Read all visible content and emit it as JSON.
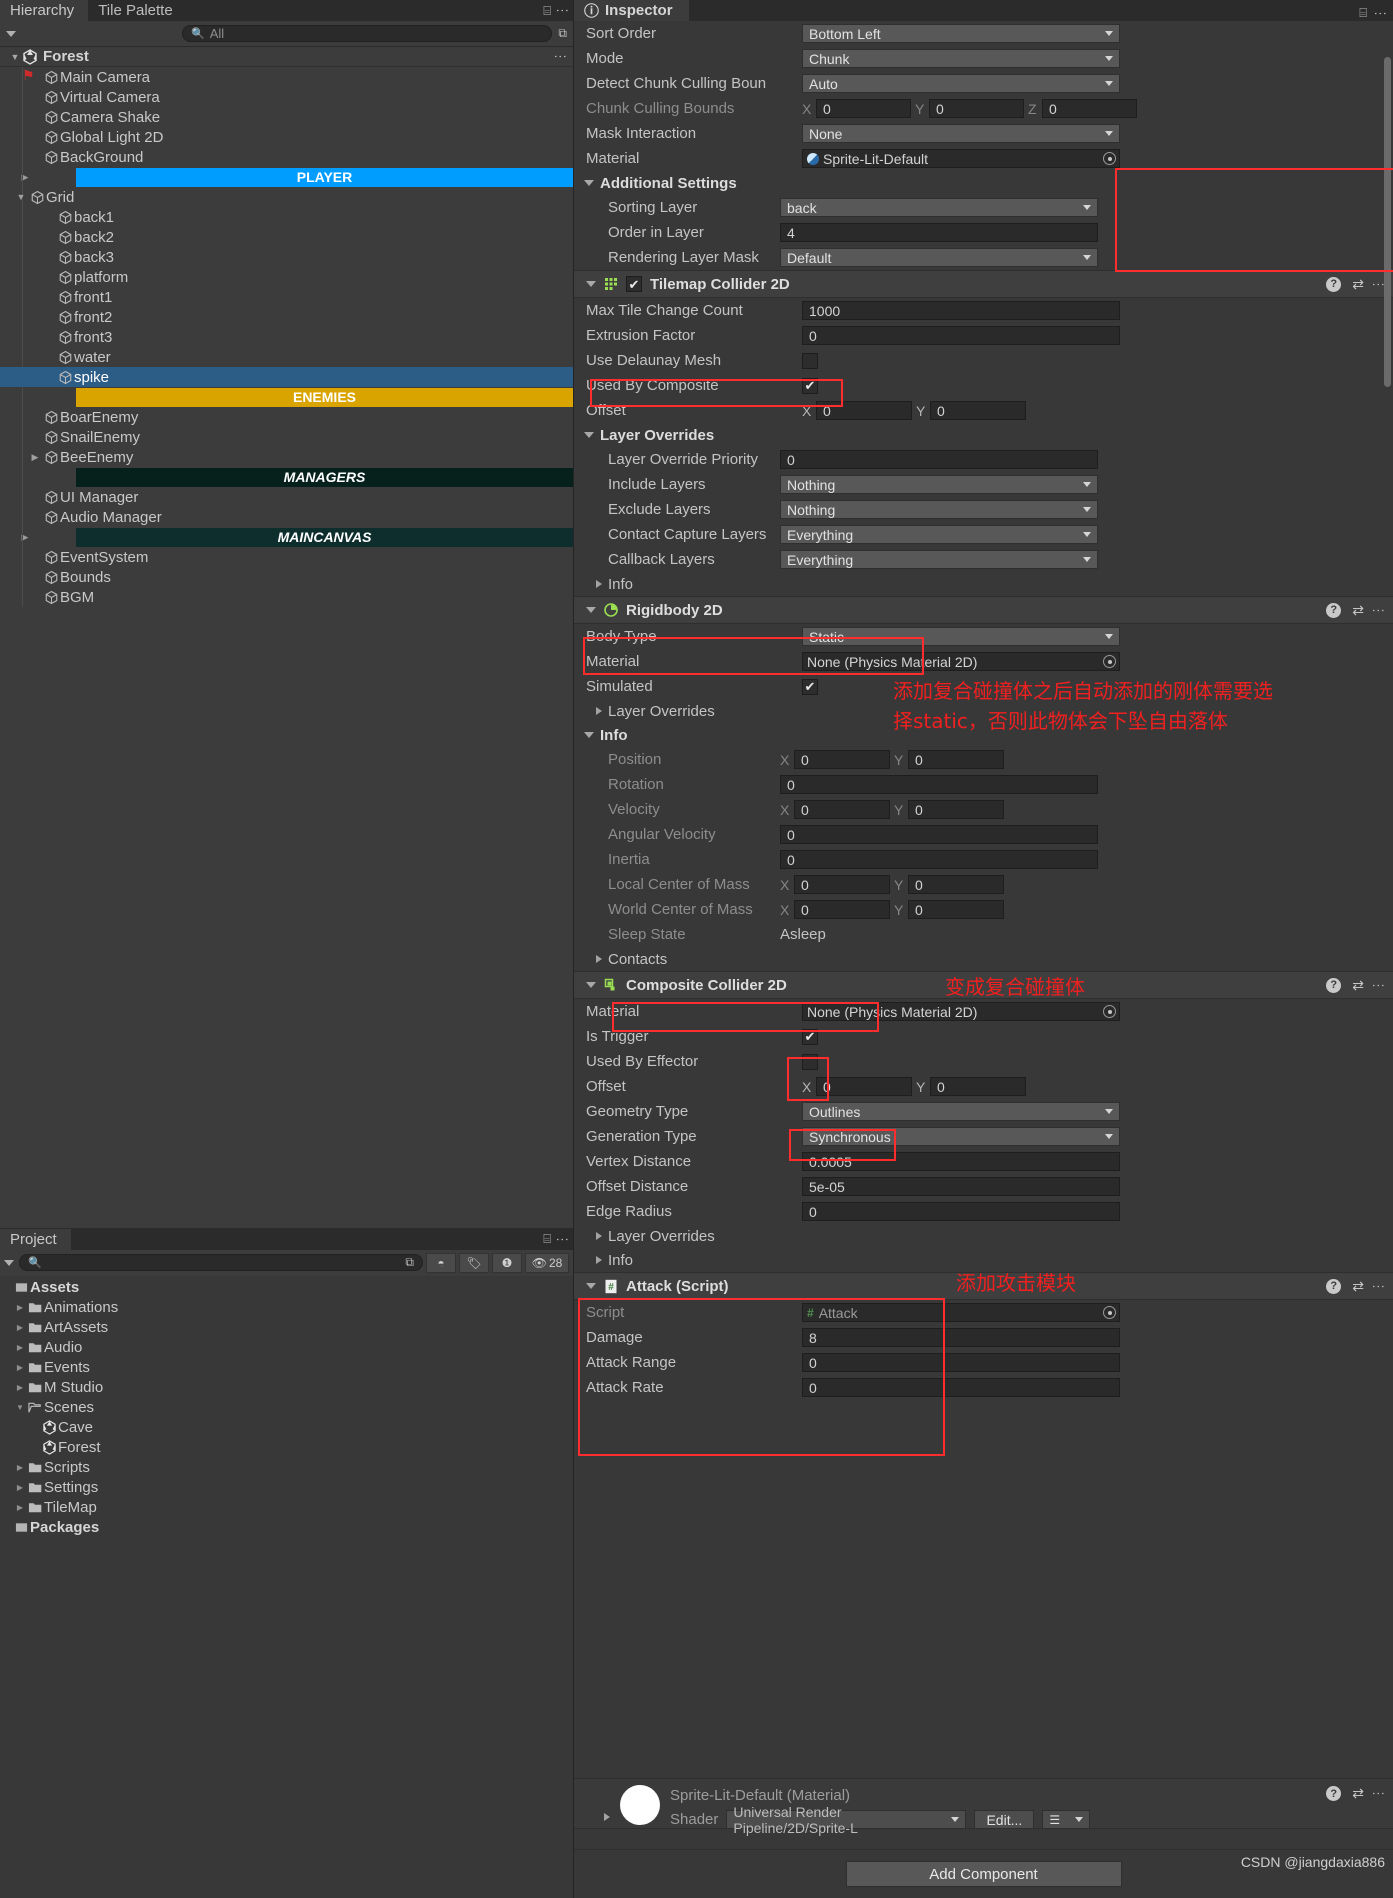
{
  "hierarchy": {
    "tabs": [
      {
        "label": "Hierarchy",
        "active": true
      },
      {
        "label": "Tile Palette",
        "active": false
      }
    ],
    "search_placeholder": "All",
    "scene_name": "Forest",
    "items": [
      {
        "label": "Main Camera",
        "indent": 2,
        "arrow": false,
        "type": "go"
      },
      {
        "label": "Virtual Camera",
        "indent": 2,
        "arrow": false,
        "type": "go"
      },
      {
        "label": "Camera Shake",
        "indent": 2,
        "arrow": false,
        "type": "go"
      },
      {
        "label": "Global Light 2D",
        "indent": 2,
        "arrow": false,
        "type": "go"
      },
      {
        "label": "BackGround",
        "indent": 2,
        "arrow": false,
        "type": "go"
      },
      {
        "label": "PLAYER",
        "indent": 2,
        "arrow": true,
        "type": "banner",
        "style": "player"
      },
      {
        "label": "Grid",
        "indent": 1,
        "arrow": true,
        "type": "go",
        "expanded": true
      },
      {
        "label": "back1",
        "indent": 3,
        "arrow": false,
        "type": "go"
      },
      {
        "label": "back2",
        "indent": 3,
        "arrow": false,
        "type": "go"
      },
      {
        "label": "back3",
        "indent": 3,
        "arrow": false,
        "type": "go"
      },
      {
        "label": "platform",
        "indent": 3,
        "arrow": false,
        "type": "go"
      },
      {
        "label": "front1",
        "indent": 3,
        "arrow": false,
        "type": "go"
      },
      {
        "label": "front2",
        "indent": 3,
        "arrow": false,
        "type": "go"
      },
      {
        "label": "front3",
        "indent": 3,
        "arrow": false,
        "type": "go"
      },
      {
        "label": "water",
        "indent": 3,
        "arrow": false,
        "type": "go"
      },
      {
        "label": "spike",
        "indent": 3,
        "arrow": false,
        "type": "go",
        "selected": true
      },
      {
        "label": "ENEMIES",
        "indent": 2,
        "arrow": false,
        "type": "banner",
        "style": "enemies"
      },
      {
        "label": "BoarEnemy",
        "indent": 2,
        "arrow": false,
        "type": "go"
      },
      {
        "label": "SnailEnemy",
        "indent": 2,
        "arrow": false,
        "type": "go"
      },
      {
        "label": "BeeEnemy",
        "indent": 2,
        "arrow": true,
        "type": "go"
      },
      {
        "label": "MANAGERS",
        "indent": 2,
        "arrow": false,
        "type": "banner",
        "style": "managers"
      },
      {
        "label": "UI Manager",
        "indent": 2,
        "arrow": false,
        "type": "go"
      },
      {
        "label": "Audio Manager",
        "indent": 2,
        "arrow": false,
        "type": "go"
      },
      {
        "label": "MAINCANVAS",
        "indent": 2,
        "arrow": true,
        "type": "banner",
        "style": "maincanvas"
      },
      {
        "label": "EventSystem",
        "indent": 2,
        "arrow": false,
        "type": "go"
      },
      {
        "label": "Bounds",
        "indent": 2,
        "arrow": false,
        "type": "go"
      },
      {
        "label": "BGM",
        "indent": 2,
        "arrow": false,
        "type": "go"
      }
    ]
  },
  "project": {
    "tab_label": "Project",
    "search_placeholder": "",
    "hidden_count": "28",
    "items": [
      {
        "label": "Assets",
        "indent": 0,
        "bold": true,
        "icon": "assets-icon",
        "arrow": false
      },
      {
        "label": "Animations",
        "indent": 1,
        "bold": false,
        "icon": "folder-icon",
        "arrow": true
      },
      {
        "label": "ArtAssets",
        "indent": 1,
        "bold": false,
        "icon": "folder-icon",
        "arrow": true
      },
      {
        "label": "Audio",
        "indent": 1,
        "bold": false,
        "icon": "folder-icon",
        "arrow": true
      },
      {
        "label": "Events",
        "indent": 1,
        "bold": false,
        "icon": "folder-icon",
        "arrow": true
      },
      {
        "label": "M Studio",
        "indent": 1,
        "bold": false,
        "icon": "folder-icon",
        "arrow": true
      },
      {
        "label": "Scenes",
        "indent": 1,
        "bold": false,
        "icon": "folder-open-icon",
        "arrow": true,
        "expanded": true
      },
      {
        "label": "Cave",
        "indent": 2,
        "bold": false,
        "icon": "unity-scene-icon",
        "arrow": false
      },
      {
        "label": "Forest",
        "indent": 2,
        "bold": false,
        "icon": "unity-scene-icon",
        "arrow": false
      },
      {
        "label": "Scripts",
        "indent": 1,
        "bold": false,
        "icon": "folder-icon",
        "arrow": true
      },
      {
        "label": "Settings",
        "indent": 1,
        "bold": false,
        "icon": "folder-icon",
        "arrow": true
      },
      {
        "label": "TileMap",
        "indent": 1,
        "bold": false,
        "icon": "folder-icon",
        "arrow": true
      },
      {
        "label": "Packages",
        "indent": 0,
        "bold": true,
        "icon": "assets-icon",
        "arrow": false
      }
    ]
  },
  "inspector": {
    "tab_label": "Inspector",
    "renderer_props": [
      {
        "label": "Sort Order",
        "value": "Bottom Left",
        "kind": "dropdown"
      },
      {
        "label": "Mode",
        "value": "Chunk",
        "kind": "dropdown"
      },
      {
        "label": "Detect Chunk Culling Boun",
        "value": "Auto",
        "kind": "dropdown"
      },
      {
        "label": "Chunk Culling Bounds",
        "kind": "xyz",
        "dim": true,
        "x": "0",
        "y": "0",
        "z": "0"
      },
      {
        "label": "Mask Interaction",
        "value": "None",
        "kind": "dropdown"
      },
      {
        "label": "Material",
        "value": "Sprite-Lit-Default",
        "kind": "object"
      }
    ],
    "additional_settings": {
      "title": "Additional Settings",
      "props": [
        {
          "label": "Sorting Layer",
          "value": "back",
          "kind": "dropdown"
        },
        {
          "label": "Order in Layer",
          "value": "4",
          "kind": "field"
        },
        {
          "label": "Rendering Layer Mask",
          "value": "Default",
          "kind": "dropdown"
        }
      ]
    },
    "tilemap_collider": {
      "title": "Tilemap Collider 2D",
      "enabled": true,
      "props": [
        {
          "label": "Max Tile Change Count",
          "value": "1000",
          "kind": "field"
        },
        {
          "label": "Extrusion Factor",
          "value": "0",
          "kind": "field"
        },
        {
          "label": "Use Delaunay Mesh",
          "kind": "check",
          "checked": false
        },
        {
          "label": "Used By Composite",
          "kind": "check",
          "checked": true
        },
        {
          "label": "Offset",
          "kind": "xy",
          "x": "0",
          "y": "0"
        }
      ],
      "layer_overrides_title": "Layer Overrides",
      "layer_overrides": [
        {
          "label": "Layer Override Priority",
          "value": "0",
          "kind": "field"
        },
        {
          "label": "Include Layers",
          "value": "Nothing",
          "kind": "dropdown"
        },
        {
          "label": "Exclude Layers",
          "value": "Nothing",
          "kind": "dropdown"
        },
        {
          "label": "Contact Capture Layers",
          "value": "Everything",
          "kind": "dropdown"
        },
        {
          "label": "Callback Layers",
          "value": "Everything",
          "kind": "dropdown"
        }
      ],
      "info_label": "Info"
    },
    "rigidbody": {
      "title": "Rigidbody 2D",
      "props": [
        {
          "label": "Body Type",
          "value": "Static",
          "kind": "dropdown"
        },
        {
          "label": "Material",
          "value": "None (Physics Material 2D)",
          "kind": "object"
        },
        {
          "label": "Simulated",
          "kind": "check",
          "checked": true
        }
      ],
      "layer_overrides_title": "Layer Overrides",
      "info_label": "Info",
      "info_props": [
        {
          "label": "Position",
          "kind": "xy",
          "x": "0",
          "y": "0"
        },
        {
          "label": "Rotation",
          "value": "0",
          "kind": "field"
        },
        {
          "label": "Velocity",
          "kind": "xy",
          "x": "0",
          "y": "0"
        },
        {
          "label": "Angular Velocity",
          "value": "0",
          "kind": "field"
        },
        {
          "label": "Inertia",
          "value": "0",
          "kind": "field"
        },
        {
          "label": "Local Center of Mass",
          "kind": "xy",
          "x": "0",
          "y": "0"
        },
        {
          "label": "World Center of Mass",
          "kind": "xy",
          "x": "0",
          "y": "0"
        },
        {
          "label": "Sleep State",
          "value": "Asleep",
          "kind": "text"
        }
      ],
      "contacts_label": "Contacts"
    },
    "composite_collider": {
      "title": "Composite Collider 2D",
      "props": [
        {
          "label": "Material",
          "value": "None (Physics Material 2D)",
          "kind": "object"
        },
        {
          "label": "Is Trigger",
          "kind": "check",
          "checked": true
        },
        {
          "label": "Used By Effector",
          "kind": "check",
          "checked": false
        },
        {
          "label": "Offset",
          "kind": "xy",
          "x": "0",
          "y": "0"
        },
        {
          "label": "Geometry Type",
          "value": "Outlines",
          "kind": "dropdown"
        },
        {
          "label": "Generation Type",
          "value": "Synchronous",
          "kind": "dropdown"
        },
        {
          "label": "Vertex Distance",
          "value": "0.0005",
          "kind": "field"
        },
        {
          "label": "Offset Distance",
          "value": "5e-05",
          "kind": "field"
        },
        {
          "label": "Edge Radius",
          "value": "0",
          "kind": "field"
        }
      ],
      "layer_overrides_title": "Layer Overrides",
      "info_label": "Info"
    },
    "attack_script": {
      "title": "Attack (Script)",
      "props": [
        {
          "label": "Script",
          "value": "Attack",
          "kind": "script"
        },
        {
          "label": "Damage",
          "value": "8",
          "kind": "field"
        },
        {
          "label": "Attack Range",
          "value": "0",
          "kind": "field"
        },
        {
          "label": "Attack Rate",
          "value": "0",
          "kind": "field"
        }
      ]
    },
    "material_footer": {
      "title": "Sprite-Lit-Default (Material)",
      "shader_label": "Shader",
      "shader_value": "Universal Render Pipeline/2D/Sprite-L",
      "edit_label": "Edit..."
    },
    "add_component_label": "Add Component"
  },
  "annotations": [
    {
      "id": "rigidbody-note",
      "line1": "添加复合碰撞体之后自动添加的刚体需要选",
      "line2": "择static，否则此物体会下坠自由落体"
    },
    {
      "id": "composite-note",
      "line1": "变成复合碰撞体"
    },
    {
      "id": "attack-note",
      "line1": "添加攻击模块"
    }
  ],
  "watermark": "CSDN @jiangdaxia886"
}
